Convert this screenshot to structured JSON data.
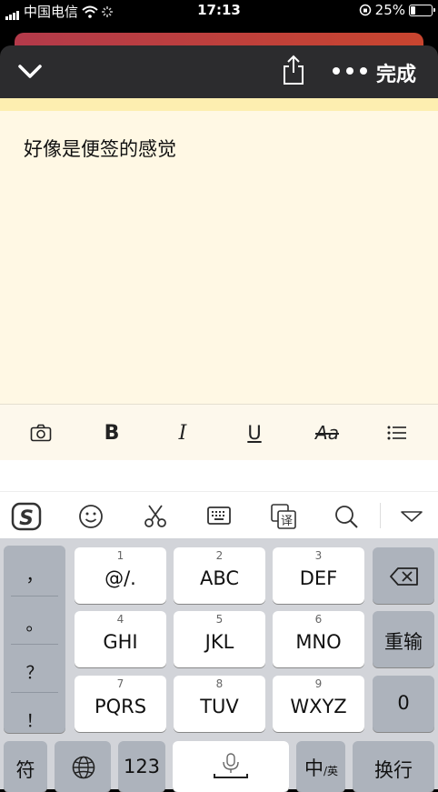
{
  "status_bar": {
    "carrier": "中国电信",
    "time": "17:13",
    "battery_percent": "25%",
    "battery_level": 0.25
  },
  "top_bar": {
    "done_label": "完成",
    "icons": [
      "chevron-down-icon",
      "share-icon",
      "more-icon"
    ]
  },
  "note": {
    "text": "好像是便签的感觉",
    "background": "#fff8e4"
  },
  "format_bar": {
    "bold_label": "B",
    "italic_label": "I",
    "underline_label": "U",
    "strike_label": "Aa",
    "icons": [
      "camera-icon",
      "list-icon"
    ]
  },
  "ime_bar": {
    "icons": [
      "sogou-logo-icon",
      "emoji-icon",
      "scissors-icon",
      "keyboard-icon",
      "translate-icon",
      "search-icon",
      "collapse-icon"
    ],
    "translate_char": "译",
    "logo_char": "S"
  },
  "keyboard": {
    "punctuation": [
      "，",
      "。",
      "？",
      "！"
    ],
    "keys": [
      {
        "num": "1",
        "label": "@/."
      },
      {
        "num": "2",
        "label": "ABC"
      },
      {
        "num": "3",
        "label": "DEF"
      },
      {
        "num": "4",
        "label": "GHI"
      },
      {
        "num": "5",
        "label": "JKL"
      },
      {
        "num": "6",
        "label": "MNO"
      },
      {
        "num": "7",
        "label": "PQRS"
      },
      {
        "num": "8",
        "label": "TUV"
      },
      {
        "num": "9",
        "label": "WXYZ"
      }
    ],
    "reinput_label": "重输",
    "zero_label": "0",
    "symbol_label": "符",
    "numeric_label": "123",
    "lang_label": "中",
    "lang_sub_label": "/英",
    "enter_label": "换行"
  }
}
